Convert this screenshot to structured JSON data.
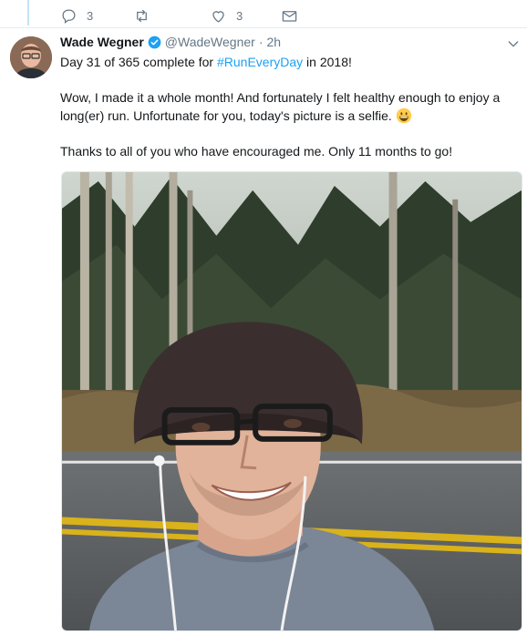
{
  "previous_tweet": {
    "reply_count": "3",
    "like_count": "3"
  },
  "tweet": {
    "author_name": "Wade Wegner",
    "handle": "@WadeWegner",
    "separator": "·",
    "time": "2h",
    "line1_before": "Day 31 of 365 complete for ",
    "hashtag": "#RunEveryDay",
    "line1_after": " in 2018!",
    "paragraph2": "Wow, I made it a whole month! And fortunately I felt healthy enough to enjoy a long(er) run. Unfortunate for you, today's picture is a selfie.",
    "paragraph3": "Thanks to all of you who have encouraged me. Only 11 months to go!"
  },
  "colors": {
    "link": "#1da1f2",
    "muted": "#657786",
    "verified": "#1da1f2",
    "thread_line": "#c4e3f7"
  },
  "icons": [
    "reply-icon",
    "retweet-icon",
    "like-icon",
    "message-icon",
    "verified-badge-icon",
    "chevron-down-icon",
    "grinning-emoji-icon"
  ]
}
